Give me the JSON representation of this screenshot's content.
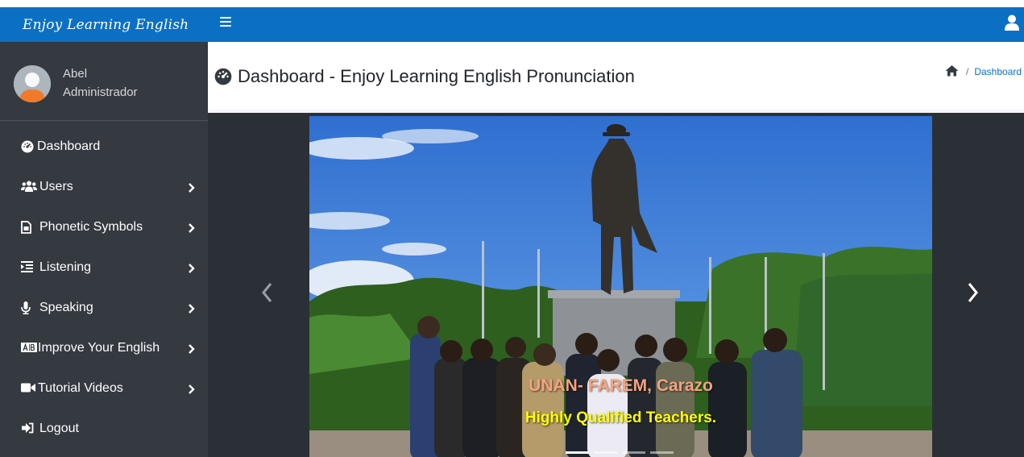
{
  "brand": {
    "title": "Enjoy Learning English"
  },
  "navbar": {
    "menu_icon": "hamburger-icon",
    "user_icon": "user-icon"
  },
  "user_panel": {
    "name": "Abel",
    "role": "Administrador"
  },
  "sidebar": {
    "items": [
      {
        "label": "Dashboard",
        "icon": "tachometer-icon",
        "has_submenu": false
      },
      {
        "label": "Users",
        "icon": "users-icon",
        "has_submenu": true
      },
      {
        "label": "Phonetic Symbols",
        "icon": "file-icon",
        "has_submenu": true
      },
      {
        "label": "Listening",
        "icon": "list-icon",
        "has_submenu": true
      },
      {
        "label": "Speaking",
        "icon": "microphone-icon",
        "has_submenu": true
      },
      {
        "label": "Improve Your English",
        "icon": "ab-icon",
        "has_submenu": true
      },
      {
        "label": "Tutorial Videos",
        "icon": "video-icon",
        "has_submenu": true
      },
      {
        "label": "Logout",
        "icon": "sign-out-icon",
        "has_submenu": false
      }
    ]
  },
  "header": {
    "title": "Dashboard - Enjoy Learning English Pronunciation",
    "breadcrumb": {
      "home_icon": "home-icon",
      "current": "Dashboard"
    }
  },
  "carousel": {
    "caption_title": "UNAN- FAREM, Carazo",
    "caption_subtitle": "Highly Qualified Teachers.",
    "slide_count": 4,
    "active_index": 0
  },
  "colors": {
    "brand_blue": "#0b70c3",
    "sidebar_bg": "#343a40",
    "caption_title": "#f4a37f",
    "caption_subtitle": "#ffff00"
  }
}
